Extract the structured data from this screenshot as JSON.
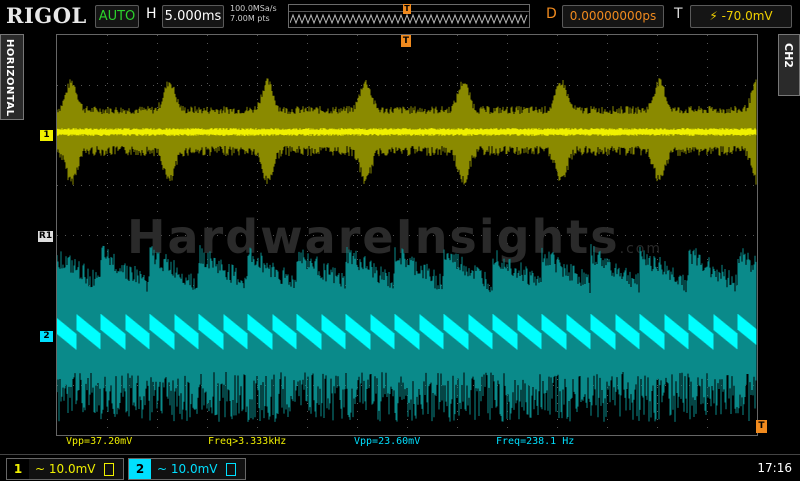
{
  "header": {
    "logo": "RIGOL",
    "run_mode": "AUTO",
    "horizontal_label": "H",
    "timebase": "5.000ms",
    "sample_rate": "100.0MSa/s",
    "memory_depth": "7.00M pts",
    "trigger_marker": "T",
    "delay_label": "D",
    "delay_value": "0.00000000ps",
    "trigger_label": "T",
    "trigger_value": "-70.0mV"
  },
  "side": {
    "left_tab": "HORIZONTAL",
    "right_tab": "CH2"
  },
  "screen": {
    "watermark": "HardwareInsights",
    "watermark_suffix": ".com",
    "ch1_marker": "1",
    "ref_marker": "R1",
    "ch2_marker": "2",
    "trigger_level_marker": "T"
  },
  "measurements": {
    "ch1_vpp": "Vpp=37.20mV",
    "ch1_freq": "Freq>3.333kHz",
    "ch2_vpp": "Vpp=23.60mV",
    "ch2_freq": "Freq=238.1 Hz"
  },
  "footer": {
    "ch1_number": "1",
    "ch1_scale": "~ 10.0mV",
    "ch2_number": "2",
    "ch2_scale": "~ 10.0mV",
    "time": "17:16"
  },
  "colors": {
    "ch1": "#f0f000",
    "ch1_envelope": "#8a8a00",
    "ch2": "#00ffff",
    "ch2_envelope": "#0a8a8a",
    "accent": "#f08a1e",
    "run_mode": "#2bd22b"
  }
}
